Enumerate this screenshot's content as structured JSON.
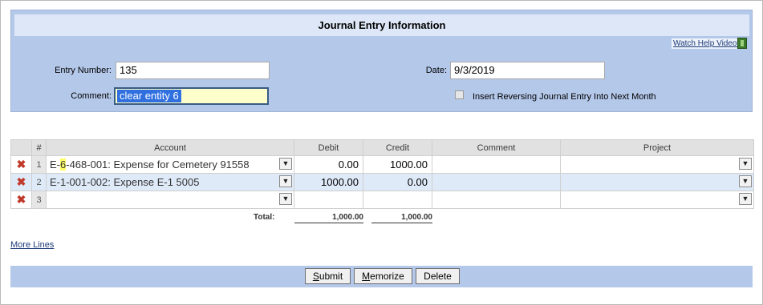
{
  "header": {
    "title": "Journal Entry Information",
    "help_link": "Watch Help Video!"
  },
  "form": {
    "entry_number_label": "Entry Number:",
    "entry_number_value": "135",
    "comment_label": "Comment:",
    "comment_value": "clear entity 6",
    "date_label": "Date:",
    "date_value": "9/3/2019",
    "reversing_label": "Insert Reversing Journal Entry Into Next Month",
    "reversing_checked": false
  },
  "grid": {
    "columns": {
      "num": "#",
      "account": "Account",
      "debit": "Debit",
      "credit": "Credit",
      "comment": "Comment",
      "project": "Project"
    },
    "rows": [
      {
        "n": "1",
        "account_pre": "E-",
        "account_hl": "6",
        "account_post": "-468-001: Expense for Cemetery 91558",
        "debit": "0.00",
        "credit": "1000.00",
        "comment": "",
        "project": ""
      },
      {
        "n": "2",
        "account_pre": "E-1-001-002: Expense E-1 5005",
        "account_hl": "",
        "account_post": "",
        "debit": "1000.00",
        "credit": "0.00",
        "comment": "",
        "project": ""
      },
      {
        "n": "3",
        "account_pre": "",
        "account_hl": "",
        "account_post": "",
        "debit": "",
        "credit": "",
        "comment": "",
        "project": ""
      }
    ],
    "total_label": "Total:",
    "total_debit": "1,000.00",
    "total_credit": "1,000.00"
  },
  "more_lines": "More Lines",
  "buttons": {
    "submit": {
      "u": "S",
      "rest": "ubmit"
    },
    "memorize": {
      "u": "M",
      "rest": "emorize"
    },
    "delete": "Delete"
  },
  "icons": {
    "delete_row": "delete-x-icon",
    "dropdown": "chevron-down-icon",
    "video": "film-icon"
  },
  "colors": {
    "panel": "#b4c8ea",
    "title_bar": "#dde7f7",
    "selection": "#2f6fe0",
    "delete": "#c0392b"
  }
}
